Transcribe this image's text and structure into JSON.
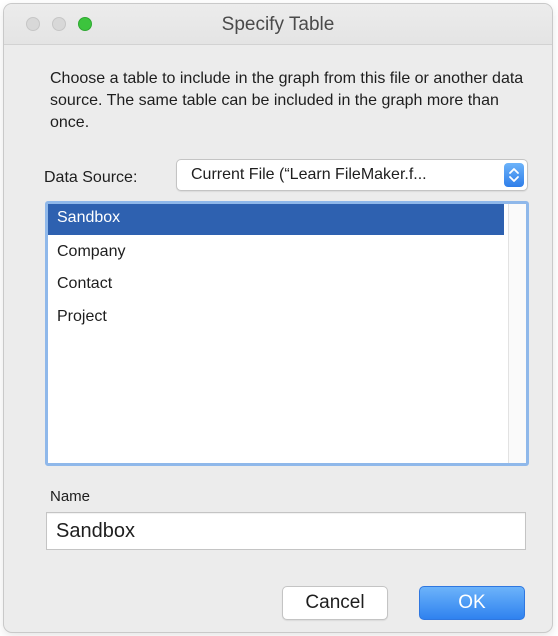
{
  "window": {
    "title": "Specify Table",
    "controls": {
      "close_icon": "close-dot-icon",
      "minimize_icon": "minimize-dot-icon",
      "zoom_icon": "zoom-dot-icon"
    }
  },
  "dialog": {
    "description": "Choose a table to include in the graph from this file or another data source.  The same table can be included in the graph more than once.",
    "data_source": {
      "label": "Data Source:",
      "selected": "Current File (“Learn FileMaker.f...",
      "stepper_icon": "up-down-chevron-icon"
    },
    "tables": [
      {
        "label": "Sandbox",
        "selected": true
      },
      {
        "label": "Company",
        "selected": false
      },
      {
        "label": "Contact",
        "selected": false
      },
      {
        "label": "Project",
        "selected": false
      }
    ],
    "name": {
      "label": "Name",
      "value": "Sandbox"
    },
    "buttons": {
      "cancel_label": "Cancel",
      "ok_label": "OK"
    }
  },
  "colors": {
    "selection": "#2e61b0",
    "accent": "#2f82ef",
    "focus_ring": "#8fb8ea",
    "zoom_dot": "#3cc43d"
  }
}
